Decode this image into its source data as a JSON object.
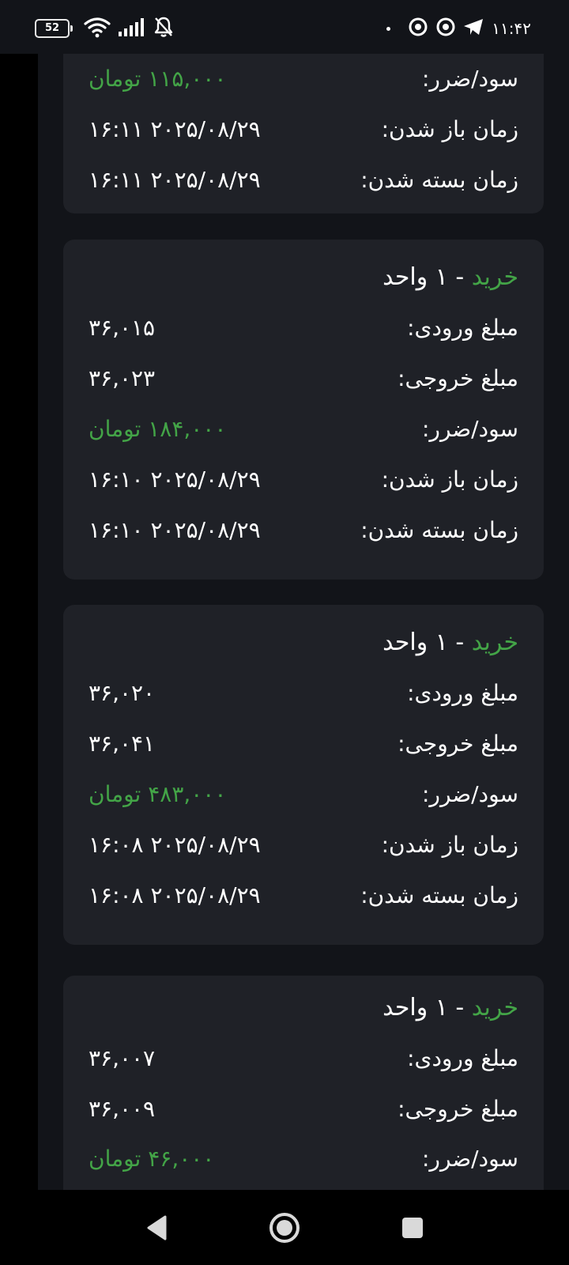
{
  "status_bar": {
    "battery_level": "52",
    "time": "۱۱:۴۲",
    "left_icons": [
      "wifi-icon",
      "signal-icon",
      "notifications-muted-icon"
    ],
    "right_icons": [
      "app-notification-icon",
      "chrome-icon",
      "telegram-icon"
    ]
  },
  "labels": {
    "entry_price": "مبلغ ورودی:",
    "exit_price": "مبلغ خروجی:",
    "profit_loss": "سود/ضرر:",
    "open_time": "زمان باز شدن:",
    "close_time": "زمان بسته شدن:",
    "separator": " - "
  },
  "cards": [
    {
      "profit_loss": "۱۱۵,۰۰۰ تومان",
      "open_time": "۲۰۲۵/۰۸/۲۹ ۱۶:۱۱",
      "close_time": "۲۰۲۵/۰۸/۲۹ ۱۶:۱۱"
    },
    {
      "type": "خرید",
      "units": "۱ واحد",
      "entry_price": "۳۶,۰۱۵",
      "exit_price": "۳۶,۰۲۳",
      "profit_loss": "۱۸۴,۰۰۰ تومان",
      "open_time": "۲۰۲۵/۰۸/۲۹ ۱۶:۱۰",
      "close_time": "۲۰۲۵/۰۸/۲۹ ۱۶:۱۰"
    },
    {
      "type": "خرید",
      "units": "۱ واحد",
      "entry_price": "۳۶,۰۲۰",
      "exit_price": "۳۶,۰۴۱",
      "profit_loss": "۴۸۳,۰۰۰ تومان",
      "open_time": "۲۰۲۵/۰۸/۲۹ ۱۶:۰۸",
      "close_time": "۲۰۲۵/۰۸/۲۹ ۱۶:۰۸"
    },
    {
      "type": "خرید",
      "units": "۱ واحد",
      "entry_price": "۳۶,۰۰۷",
      "exit_price": "۳۶,۰۰۹",
      "profit_loss": "۴۶,۰۰۰ تومان"
    }
  ],
  "colors": {
    "profit": "#43a447",
    "card_background": "#1f2127",
    "page_background": "#121419"
  },
  "nav_bar": {
    "icons": [
      "back-icon",
      "home-icon",
      "recents-icon"
    ]
  }
}
